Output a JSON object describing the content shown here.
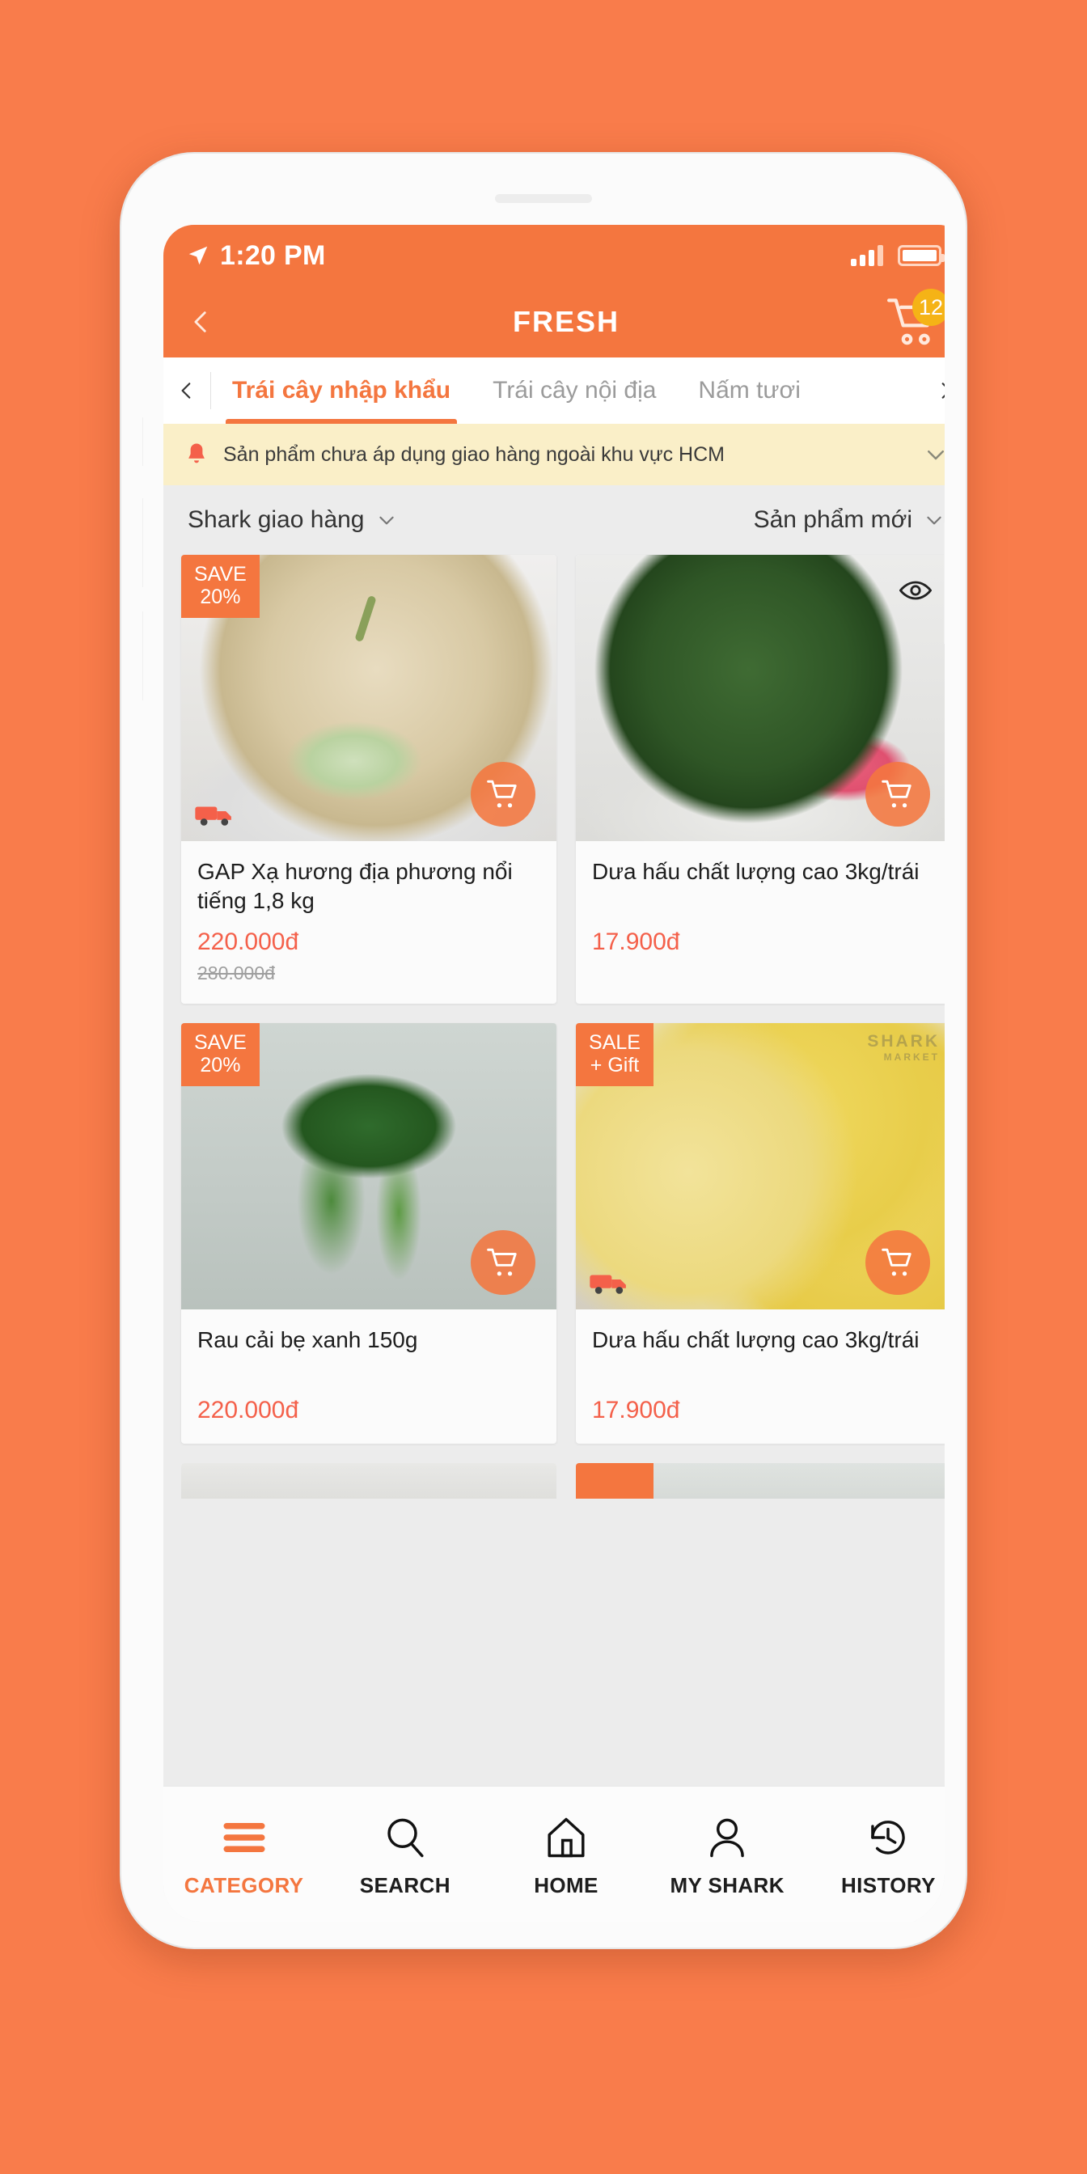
{
  "status_bar": {
    "time": "1:20 PM",
    "location_icon": "location-arrow-icon",
    "signal_icon": "signal-bars-icon",
    "battery_icon": "battery-full-icon"
  },
  "app_bar": {
    "back_icon": "chevron-left-icon",
    "title": "FRESH",
    "cart_icon": "shopping-cart-icon",
    "cart_count": "12"
  },
  "category_tabs": {
    "prev_icon": "chevron-left-icon",
    "next_icon": "chevron-right-icon",
    "items": [
      {
        "label": "Trái cây nhập khẩu",
        "active": true
      },
      {
        "label": "Trái cây nội địa",
        "active": false
      },
      {
        "label": "Nấm tươi",
        "active": false
      }
    ]
  },
  "notice": {
    "bell_icon": "bell-icon",
    "text": "Sản phẩm chưa áp dụng giao hàng ngoài khu vực HCM",
    "expand_icon": "chevron-down-icon"
  },
  "filters": {
    "left": {
      "label": "Shark giao hàng",
      "icon": "chevron-down-icon"
    },
    "right": {
      "label": "Sản phẩm mới",
      "icon": "chevron-down-icon"
    }
  },
  "products": [
    {
      "badge_line1": "SAVE",
      "badge_line2": "20%",
      "title": "GAP Xạ hương địa phương nổi tiếng 1,8 kg",
      "price": "220.000đ",
      "old_price": "280.000đ",
      "art": "art-melon",
      "has_truck": true,
      "has_eye": false,
      "cart_icon": "add-to-cart-icon",
      "watermark": ""
    },
    {
      "badge_line1": "",
      "badge_line2": "",
      "title": "Dưa hấu chất lượng cao 3kg/trái",
      "price": "17.900đ",
      "old_price": "",
      "art": "art-watermelon",
      "has_truck": false,
      "has_eye": true,
      "cart_icon": "add-to-cart-icon",
      "watermark": ""
    },
    {
      "badge_line1": "SAVE",
      "badge_line2": "20%",
      "title": "Rau cải bẹ xanh 150g",
      "price": "220.000đ",
      "old_price": "",
      "art": "art-greens",
      "has_truck": false,
      "has_eye": false,
      "cart_icon": "add-to-cart-icon",
      "watermark": ""
    },
    {
      "badge_line1": "SALE",
      "badge_line2": "+ Gift",
      "title": "Dưa hấu chất lượng cao 3kg/trái",
      "price": "17.900đ",
      "old_price": "",
      "art": "art-yellowmelon",
      "has_truck": true,
      "has_eye": false,
      "cart_icon": "add-to-cart-icon",
      "watermark": "SHARK"
    }
  ],
  "bottom_nav": {
    "items": [
      {
        "label": "CATEGORY",
        "icon": "hamburger-menu-icon",
        "active": true
      },
      {
        "label": "SEARCH",
        "icon": "magnifier-icon",
        "active": false
      },
      {
        "label": "HOME",
        "icon": "house-icon",
        "active": false
      },
      {
        "label": "MY SHARK",
        "icon": "person-icon",
        "active": false
      },
      {
        "label": "HISTORY",
        "icon": "clock-rewind-icon",
        "active": false
      }
    ]
  },
  "colors": {
    "brand_orange": "#F4763F",
    "page_background": "#F97C4B",
    "price_red": "#F4604A",
    "badge_yellow": "#F5B316",
    "notice_bg": "#FAEFC8"
  }
}
